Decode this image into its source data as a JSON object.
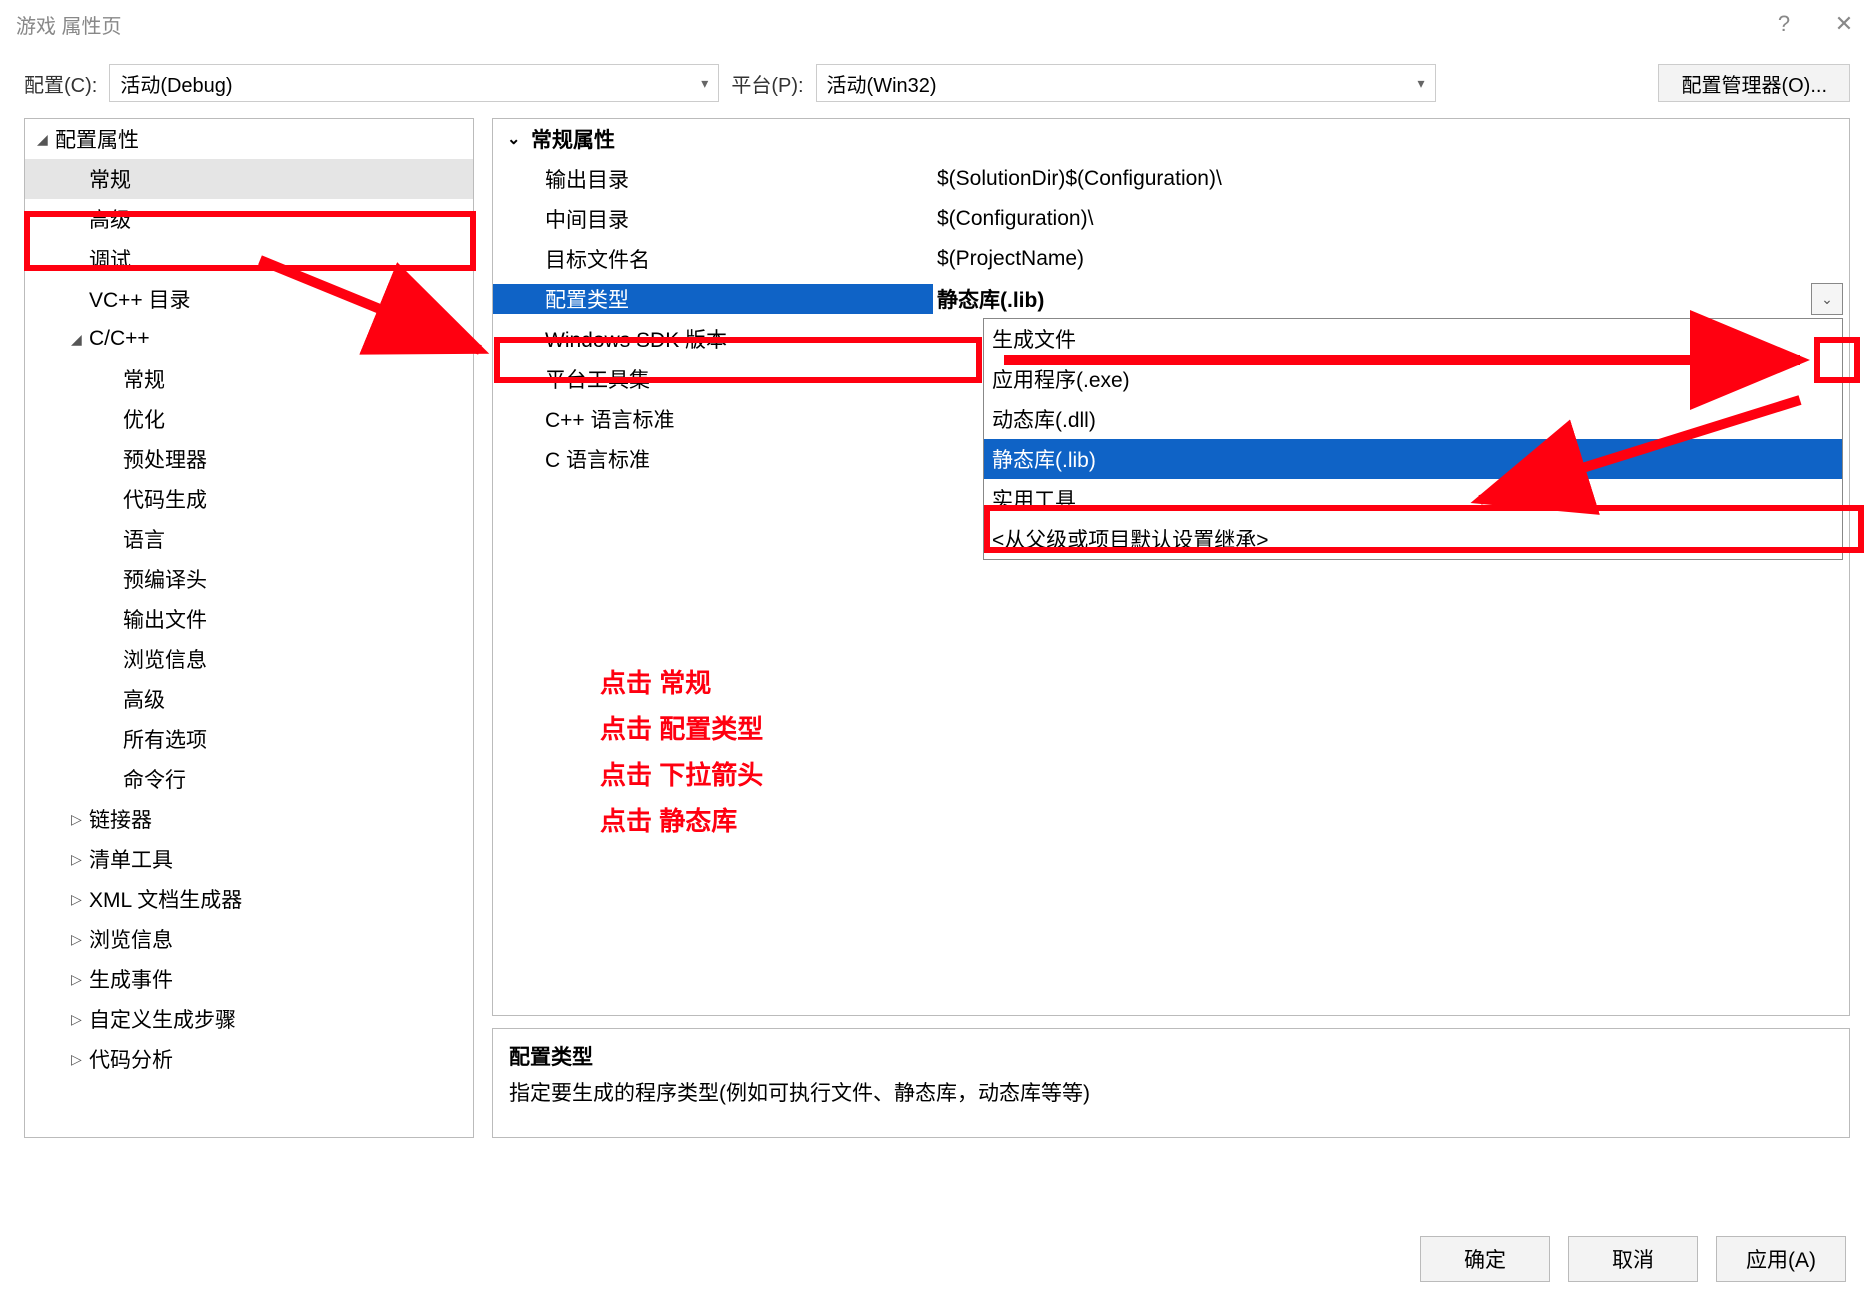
{
  "title": "游戏 属性页",
  "titlebar": {
    "help": "?",
    "close": "✕"
  },
  "configRow": {
    "configLabel": "配置(C):",
    "configValue": "活动(Debug)",
    "platformLabel": "平台(P):",
    "platformValue": "活动(Win32)",
    "managerButton": "配置管理器(O)..."
  },
  "tree": [
    {
      "label": "配置属性",
      "depth": 0,
      "expander": "◢"
    },
    {
      "label": "常规",
      "depth": 1,
      "selected": true
    },
    {
      "label": "高级",
      "depth": 1
    },
    {
      "label": "调试",
      "depth": 1
    },
    {
      "label": "VC++ 目录",
      "depth": 1
    },
    {
      "label": "C/C++",
      "depth": 1,
      "expander": "◢"
    },
    {
      "label": "常规",
      "depth": 2
    },
    {
      "label": "优化",
      "depth": 2
    },
    {
      "label": "预处理器",
      "depth": 2
    },
    {
      "label": "代码生成",
      "depth": 2
    },
    {
      "label": "语言",
      "depth": 2
    },
    {
      "label": "预编译头",
      "depth": 2
    },
    {
      "label": "输出文件",
      "depth": 2
    },
    {
      "label": "浏览信息",
      "depth": 2
    },
    {
      "label": "高级",
      "depth": 2
    },
    {
      "label": "所有选项",
      "depth": 2
    },
    {
      "label": "命令行",
      "depth": 2
    },
    {
      "label": "链接器",
      "depth": 1,
      "expander": "▷"
    },
    {
      "label": "清单工具",
      "depth": 1,
      "expander": "▷"
    },
    {
      "label": "XML 文档生成器",
      "depth": 1,
      "expander": "▷"
    },
    {
      "label": "浏览信息",
      "depth": 1,
      "expander": "▷"
    },
    {
      "label": "生成事件",
      "depth": 1,
      "expander": "▷"
    },
    {
      "label": "自定义生成步骤",
      "depth": 1,
      "expander": "▷"
    },
    {
      "label": "代码分析",
      "depth": 1,
      "expander": "▷"
    }
  ],
  "propHeader": "常规属性",
  "props": [
    {
      "name": "输出目录",
      "value": "$(SolutionDir)$(Configuration)\\"
    },
    {
      "name": "中间目录",
      "value": "$(Configuration)\\"
    },
    {
      "name": "目标文件名",
      "value": "$(ProjectName)"
    },
    {
      "name": "配置类型",
      "value": "静态库(.lib)",
      "selected": true
    },
    {
      "name": "Windows SDK 版本",
      "value": ""
    },
    {
      "name": "平台工具集",
      "value": ""
    },
    {
      "name": "C++ 语言标准",
      "value": ""
    },
    {
      "name": "C 语言标准",
      "value": ""
    }
  ],
  "dropdown": {
    "items": [
      {
        "label": "生成文件"
      },
      {
        "label": "应用程序(.exe)"
      },
      {
        "label": "动态库(.dll)"
      },
      {
        "label": "静态库(.lib)",
        "selected": true
      },
      {
        "label": "实用工具"
      },
      {
        "label": "<从父级或项目默认设置继承>"
      }
    ]
  },
  "desc": {
    "title": "配置类型",
    "text": "指定要生成的程序类型(例如可执行文件、静态库，动态库等等)"
  },
  "buttons": {
    "ok": "确定",
    "cancel": "取消",
    "apply": "应用(A)"
  },
  "annotations": {
    "line1": "点击 常规",
    "line2": "点击 配置类型",
    "line3": "点击 下拉箭头",
    "line4": "点击 静态库"
  }
}
